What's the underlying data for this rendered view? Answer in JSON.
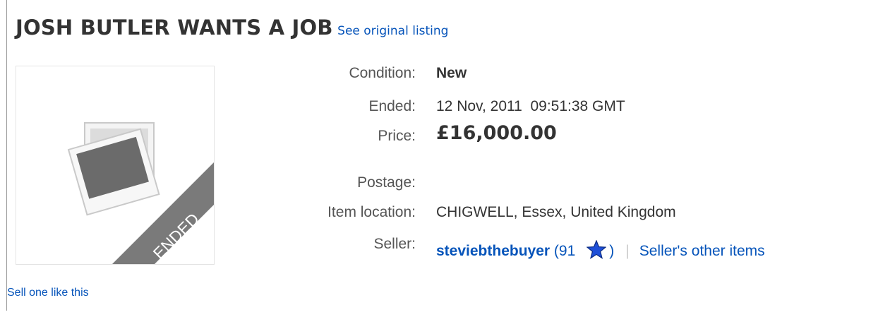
{
  "listing": {
    "title": "JOSH BUTLER WANTS A JOB",
    "see_original": "See original listing"
  },
  "image": {
    "ribbon_text": "ENDED"
  },
  "details": {
    "condition_label": "Condition:",
    "condition_value": "New",
    "ended_label": "Ended:",
    "ended_value": "12 Nov, 2011  09:51:38 GMT",
    "price_label": "Price:",
    "price_value": "£16,000.00",
    "postage_label": "Postage:",
    "location_label": "Item location:",
    "location_value": "CHIGWELL, Essex, United Kingdom",
    "seller_label": "Seller:",
    "seller_name": "steviebthebuyer",
    "feedback_open": "(91",
    "feedback_close": ")",
    "separator": "|",
    "other_items": "Seller's other items"
  },
  "footer": {
    "sell_link": "Sell one like this"
  },
  "colors": {
    "link": "#0654ba",
    "star": "#1e4fd8"
  },
  "icons": {
    "star": "blue-star-icon",
    "placeholder": "photo-placeholder-icon"
  }
}
